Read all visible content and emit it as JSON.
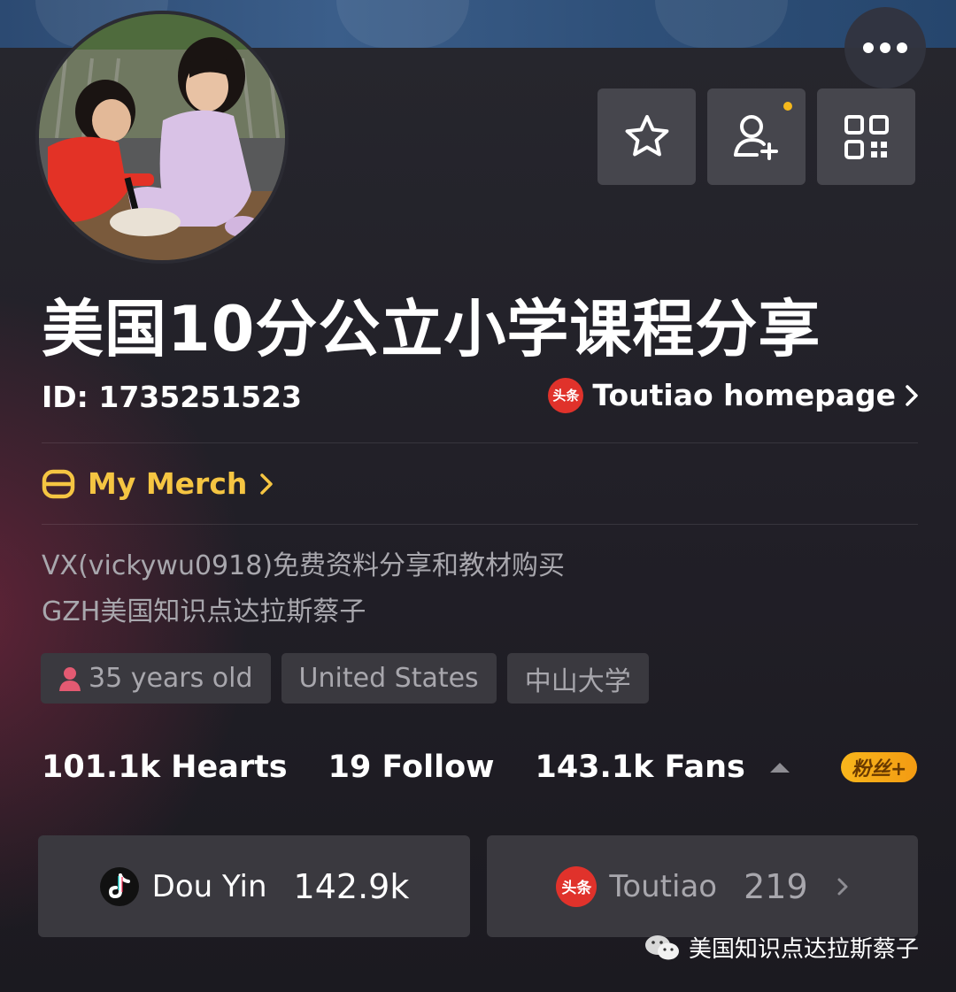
{
  "header": {
    "more_label": "more",
    "avatar_alt": "profile avatar"
  },
  "profile": {
    "name": "美国10分公立小学课程分享",
    "id_text": "ID: 1735251523",
    "toutiao_badge": "头条",
    "toutiao_link": "Toutiao homepage",
    "merch_label": "My Merch",
    "bio_line1": "VX(vickywu0918)免费资料分享和教材购买",
    "bio_line2": "GZH美国知识点达拉斯蔡子",
    "tags": {
      "age": "35 years old",
      "location": "United States",
      "school": "中山大学"
    }
  },
  "stats": {
    "hearts": "101.1k Hearts",
    "follow": "19 Follow",
    "fans": "143.1k Fans",
    "fans_badge": "粉丝+"
  },
  "platforms": {
    "douyin_name": "Dou Yin",
    "douyin_count": "142.9k",
    "toutiao_badge": "头条",
    "toutiao_name": "Toutiao",
    "toutiao_count": "219"
  },
  "watermark": {
    "text": "美国知识点达拉斯蔡子"
  },
  "colors": {
    "accent_gold": "#f5c542",
    "toutiao_red": "#e0322b",
    "notify_dot": "#f5b81c"
  },
  "icons": [
    "star-icon",
    "add-user-icon",
    "qr-code-icon",
    "chevron-right-icon",
    "merch-icon",
    "person-icon",
    "caret-up-icon",
    "douyin-icon",
    "wechat-icon"
  ]
}
